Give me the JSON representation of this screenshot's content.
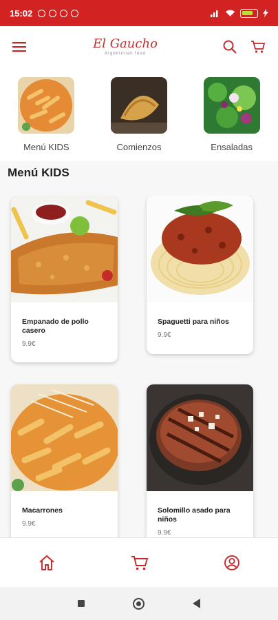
{
  "status_bar": {
    "time": "15:02",
    "battery": "55",
    "battery_level": 0.55
  },
  "header": {
    "logo_text": "El Gaucho",
    "logo_tagline": "Argentinian food"
  },
  "categories": [
    {
      "label": "Menú KIDS",
      "icon": "pasta-photo"
    },
    {
      "label": "Comienzos",
      "icon": "empanada-photo"
    },
    {
      "label": "Ensaladas",
      "icon": "salad-photo"
    }
  ],
  "section": {
    "title": "Menú KIDS"
  },
  "products": [
    {
      "name": "Empanado de pollo casero",
      "price": "9.9€"
    },
    {
      "name": "Spaguetti para niños",
      "price": "9.9€"
    },
    {
      "name": "Macarrones",
      "price": "9.9€"
    },
    {
      "name": "Solomillo asado para niños",
      "price": "9.9€"
    }
  ],
  "colors": {
    "brand": "#d32222",
    "accent_icon": "#c62828"
  },
  "bottom_nav": [
    "home-icon",
    "cart-icon",
    "user-icon"
  ]
}
